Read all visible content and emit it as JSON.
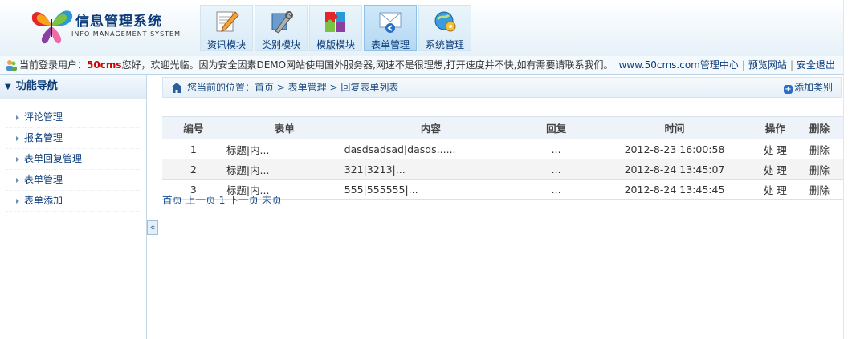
{
  "header": {
    "title": "信息管理系统",
    "subtitle": "INFO MANAGEMENT SYSTEM",
    "nav": [
      {
        "label": "资讯模块",
        "icon": "pencil-paper-icon",
        "active": false
      },
      {
        "label": "类别模块",
        "icon": "tools-icon",
        "active": false
      },
      {
        "label": "模版模块",
        "icon": "puzzle-icon",
        "active": false
      },
      {
        "label": "表单管理",
        "icon": "mail-icon",
        "active": true
      },
      {
        "label": "系统管理",
        "icon": "gear-globe-icon",
        "active": false
      }
    ]
  },
  "infobar": {
    "prefix": "当前登录用户：",
    "username": "50cms",
    "message": "您好，欢迎光临。因为安全因素DEMO网站使用国外服务器,网速不是很理想,打开速度并不快,如有需要请联系我们。",
    "site": "www.50cms.com",
    "links": [
      "管理中心",
      "预览网站",
      "安全退出"
    ]
  },
  "sidebar": {
    "title": "功能导航",
    "items": [
      "评论管理",
      "报名管理",
      "表单回复管理",
      "表单管理",
      "表单添加"
    ]
  },
  "breadcrumb": {
    "label": "您当前的位置：首页 > 表单管理 > 回复表单列表",
    "action": "添加类别"
  },
  "table": {
    "headers": [
      "编号",
      "表单",
      "内容",
      "回复",
      "时间",
      "操作",
      "删除"
    ],
    "rows": [
      {
        "id": "1",
        "form": "标题|内...",
        "content": "dasdsadsad|dasds......",
        "reply": "...",
        "time": "2012-8-23 16:00:58",
        "op": "处 理",
        "del": "删除"
      },
      {
        "id": "2",
        "form": "标题|内...",
        "content": "321|3213|...",
        "reply": "...",
        "time": "2012-8-24 13:45:07",
        "op": "处 理",
        "del": "删除"
      },
      {
        "id": "3",
        "form": "标题|内...",
        "content": "555|555555|...",
        "reply": "...",
        "time": "2012-8-24 13:45:45",
        "op": "处 理",
        "del": "删除"
      }
    ]
  },
  "pager": [
    "首页",
    "上一页",
    "1",
    "下一页",
    "末页"
  ],
  "collapse_glyph": "«",
  "colors": {
    "accent": "#0c3c7a",
    "highlight": "#d40000"
  }
}
